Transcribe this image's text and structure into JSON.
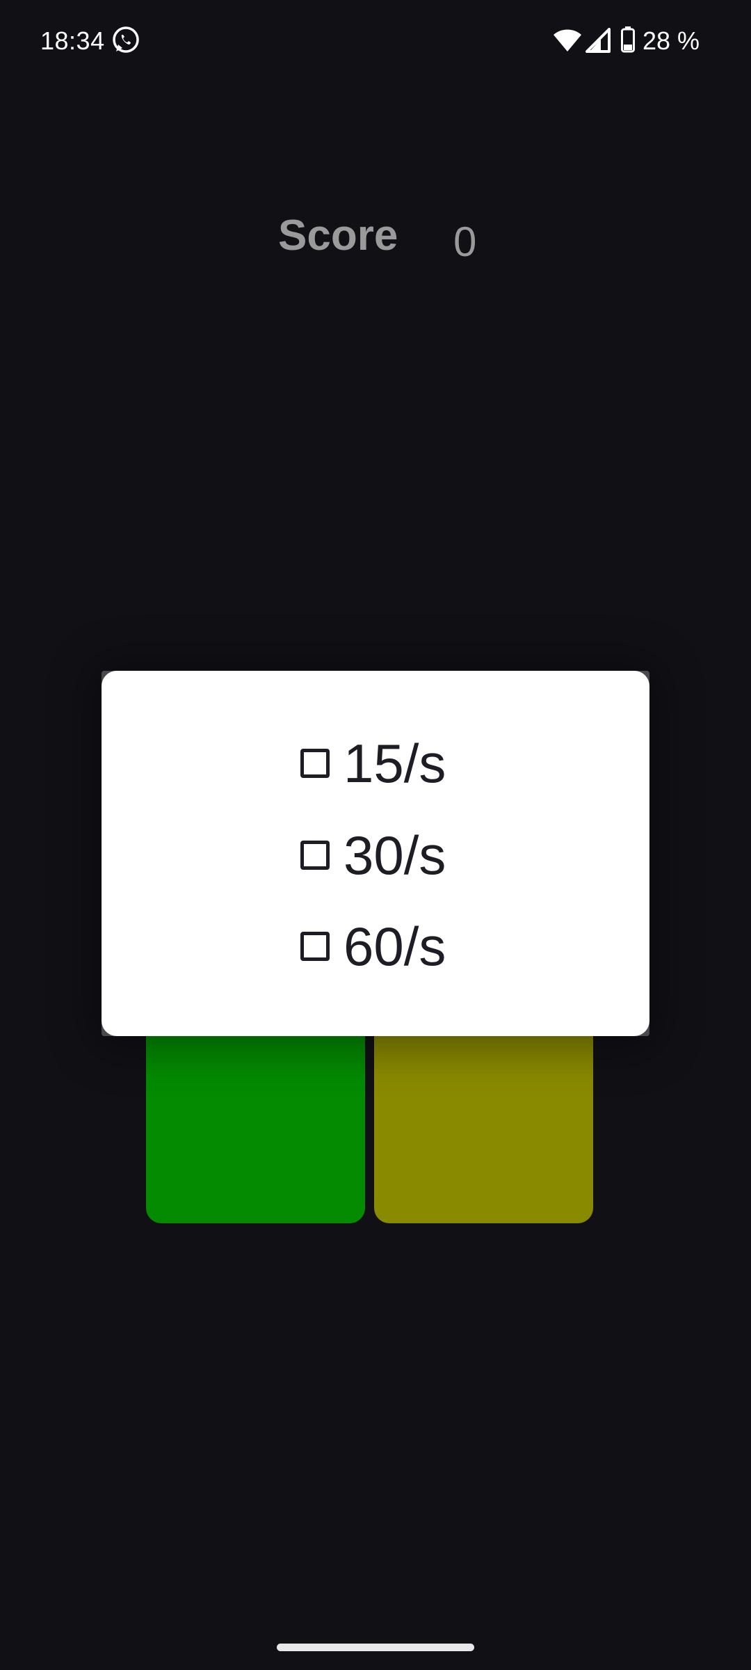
{
  "status_bar": {
    "time": "18:34",
    "battery_text": "28 %",
    "icons": [
      "whatsapp-icon",
      "wifi-icon",
      "signal-icon",
      "battery-icon"
    ]
  },
  "score": {
    "label": "Score",
    "value": "0"
  },
  "dialog": {
    "options": [
      {
        "label": "15/s",
        "checked": false
      },
      {
        "label": "30/s",
        "checked": false
      },
      {
        "label": "60/s",
        "checked": false
      }
    ]
  },
  "tiles": [
    {
      "name": "green",
      "color": "#048b02"
    },
    {
      "name": "olive",
      "color": "#8a8a00"
    }
  ],
  "colors": {
    "background": "#111015",
    "dialog": "#ffffff",
    "score_text": "#9a9a9a"
  }
}
